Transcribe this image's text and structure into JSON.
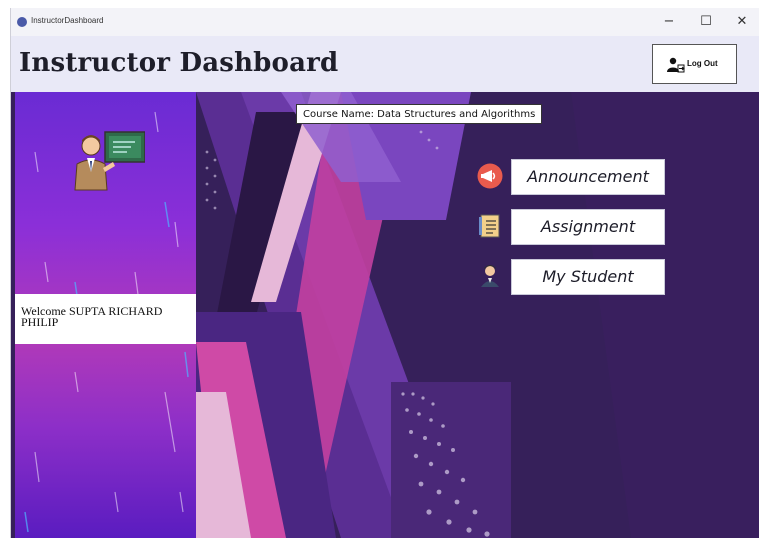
{
  "window": {
    "title": "InstructorDashboard",
    "controls": [
      "−",
      "☐",
      "✕"
    ]
  },
  "header": {
    "title": "Instructor Dashboard",
    "logout_label": "Log Out"
  },
  "course": {
    "label": "Course Name: Data Structures and Algorithms"
  },
  "sidebar": {
    "welcome_text": "Welcome SUPTA RICHARD PHILIP"
  },
  "nav": {
    "announcement": "Announcement",
    "assignment": "Assignment",
    "my_student": "My Student"
  },
  "colors": {
    "accent": "#6a2bd3",
    "background": "#3a1f5c",
    "header_bg": "#e9e9f7"
  }
}
